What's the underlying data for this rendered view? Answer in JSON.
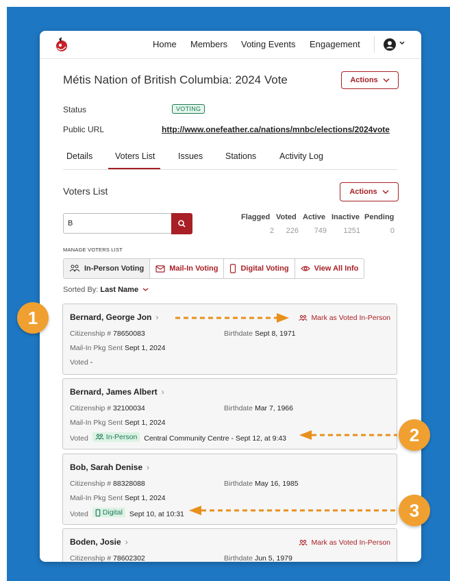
{
  "nav": {
    "links": [
      "Home",
      "Members",
      "Voting Events",
      "Engagement"
    ]
  },
  "page": {
    "title": "Métis Nation of British Columbia: 2024 Vote",
    "actions_label": "Actions",
    "status_label": "Status",
    "status_value": "VOTING",
    "url_label": "Public URL",
    "url_value": "http://www.onefeather.ca/nations/mnbc/elections/2024vote"
  },
  "tabs": [
    "Details",
    "Voters List",
    "Issues",
    "Stations",
    "Activity Log"
  ],
  "active_tab": "Voters List",
  "voters_list": {
    "heading": "Voters List",
    "actions_label": "Actions",
    "search_value": "B",
    "stats": {
      "headers": [
        "Flagged",
        "Voted",
        "Active",
        "Inactive",
        "Pending"
      ],
      "values": [
        "2",
        "226",
        "749",
        "1251",
        "0"
      ]
    },
    "manage_label": "MANAGE VOTERS LIST",
    "buttons": [
      "In-Person Voting",
      "Mail-In Voting",
      "Digital Voting",
      "View All Info"
    ],
    "sorted_prefix": "Sorted By:",
    "sorted_value": "Last Name"
  },
  "voters": [
    {
      "name": "Bernard, George Jon",
      "citizenship_label": "Citizenship #",
      "citizenship": "78650083",
      "birthdate_label": "Birthdate",
      "birthdate": "Sept 8, 1971",
      "mail_label": "Mail-In Pkg Sent",
      "mail": "Sept 1, 2024",
      "voted_label": "Voted",
      "voted": "-",
      "action": "Mark as Voted In-Person"
    },
    {
      "name": "Bernard, James Albert",
      "citizenship_label": "Citizenship #",
      "citizenship": "32100034",
      "birthdate_label": "Birthdate",
      "birthdate": "Mar 7, 1966",
      "mail_label": "Mail-In Pkg Sent",
      "mail": "Sept 1, 2024",
      "voted_label": "Voted",
      "voted_method": "In-Person",
      "voted_detail": "Central Community Centre - Sept 12, at 9:43"
    },
    {
      "name": "Bob, Sarah Denise",
      "citizenship_label": "Citizenship #",
      "citizenship": "88328088",
      "birthdate_label": "Birthdate",
      "birthdate": "May 16, 1985",
      "mail_label": "Mail-In Pkg Sent",
      "mail": "Sept 1, 2024",
      "voted_label": "Voted",
      "voted_method": "Digital",
      "voted_detail": "Sept 10, at 10:31"
    },
    {
      "name": "Boden, Josie",
      "citizenship_label": "Citizenship #",
      "citizenship": "78602302",
      "birthdate_label": "Birthdate",
      "birthdate": "Jun 5, 1979",
      "action": "Mark as Voted In-Person"
    }
  ],
  "callouts": [
    "1",
    "2",
    "3"
  ],
  "colors": {
    "brand_red": "#a81f25",
    "voting_green": "#1d7a55",
    "callout_orange": "#f0a030",
    "background_blue": "#1e77c2"
  },
  "icons": [
    "logo-icon",
    "account-icon",
    "search-icon",
    "people-icon",
    "mail-icon",
    "phone-icon",
    "eye-icon",
    "chevron-down-icon",
    "chevron-right-icon"
  ]
}
